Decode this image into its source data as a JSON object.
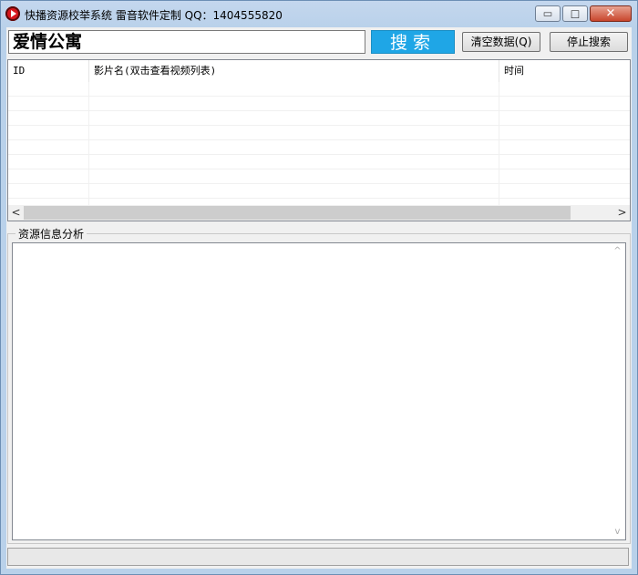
{
  "window": {
    "title": "快播资源校举系统  雷音软件定制  QQ：1404555820",
    "minimize_glyph": "▭",
    "maximize_glyph": "□",
    "close_glyph": "✕"
  },
  "toolbar": {
    "search_value": "爱情公寓",
    "search_label": "搜索",
    "clear_label": "清空数据(Q)",
    "stop_label": "停止搜索"
  },
  "list": {
    "columns": [
      "ID",
      "影片名(双击查看视频列表)",
      "时间"
    ],
    "scroll_left": "<",
    "scroll_right": ">"
  },
  "info_panel": {
    "label": "资源信息分析",
    "scroll_up": "^",
    "scroll_down": "v"
  },
  "colors": {
    "search_button": "#1fa6e6",
    "window_frame": "#b9d1ea",
    "close_button": "#c8452c"
  }
}
